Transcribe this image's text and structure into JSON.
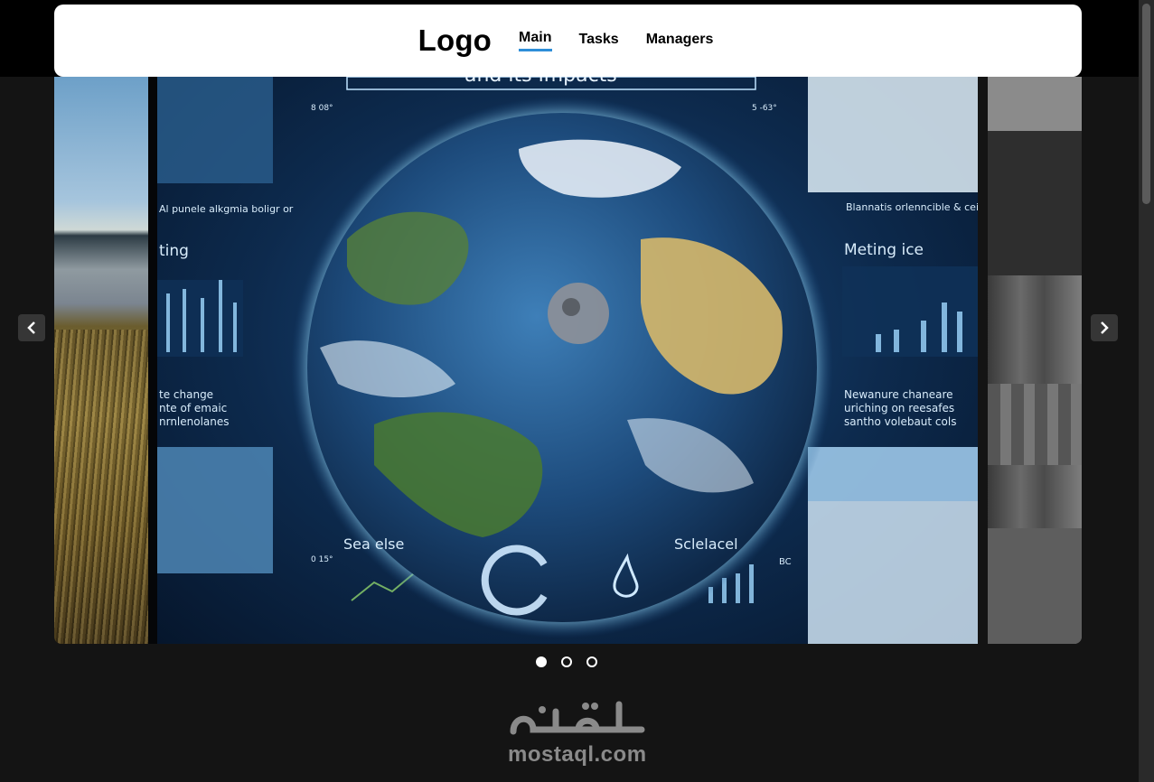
{
  "header": {
    "logo": "Logo",
    "nav": [
      {
        "label": "Main",
        "active": true
      },
      {
        "label": "Tasks",
        "active": false
      },
      {
        "label": "Managers",
        "active": false
      }
    ],
    "active_accent": "#2e8ed8"
  },
  "carousel": {
    "slides_total": 3,
    "active_index": 0,
    "center_slide_text": {
      "title_partial": "and its impacts",
      "left_caption_top": "Al punele alkgmia boligr or",
      "left_heading": "ting",
      "left_block": [
        "te change",
        "nte of emaic",
        "nrnlenolanes"
      ],
      "left_bottom": "Sea else",
      "right_caption_top": "Blannatis orlenncible & ceil on tle",
      "right_heading": "Meting ice",
      "right_block": [
        "Newanure chaneare",
        "uriching on reesafes",
        "santho volebaut cols"
      ],
      "right_bottom": "Sclelacel",
      "small_values": [
        "8 08°",
        "5 -63°",
        "0 15°",
        "BC"
      ]
    },
    "prev_icon": "chevron-left-icon",
    "next_icon": "chevron-right-icon"
  },
  "watermark": {
    "arabic": "مستقل",
    "latin": "mostaql.com"
  }
}
